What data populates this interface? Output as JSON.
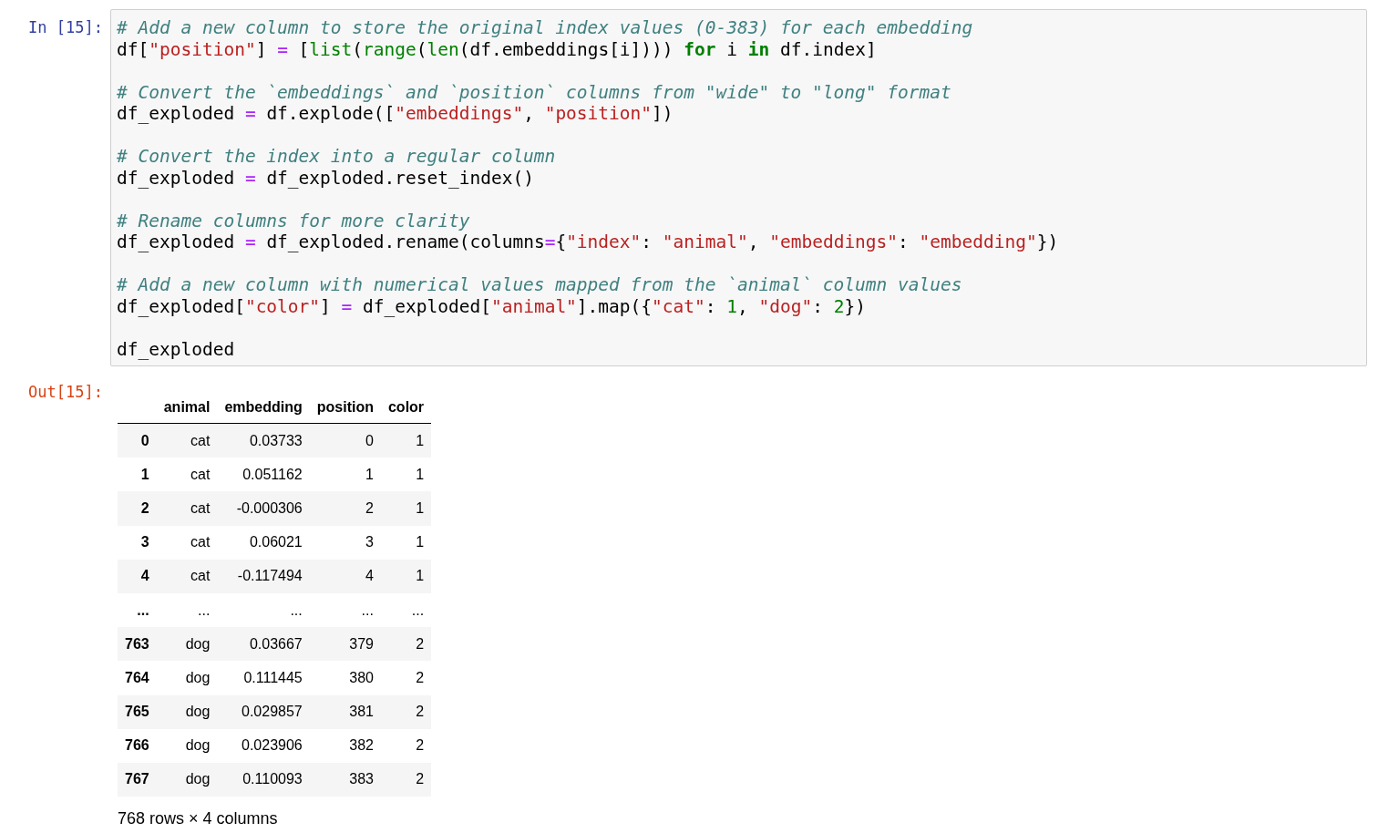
{
  "input_cell": {
    "prompt": "In [15]:",
    "blocks": [
      [
        [
          {
            "kind": "comment",
            "text": "# Add a new column to store the original index values (0-383) for each embedding"
          }
        ],
        [
          {
            "kind": "plain",
            "text": "df["
          },
          {
            "kind": "string",
            "text": "\"position\""
          },
          {
            "kind": "plain",
            "text": "] "
          },
          {
            "kind": "operator",
            "text": "="
          },
          {
            "kind": "plain",
            "text": " ["
          },
          {
            "kind": "builtin",
            "text": "list"
          },
          {
            "kind": "plain",
            "text": "("
          },
          {
            "kind": "builtin",
            "text": "range"
          },
          {
            "kind": "plain",
            "text": "("
          },
          {
            "kind": "builtin",
            "text": "len"
          },
          {
            "kind": "plain",
            "text": "(df.embeddings[i]))) "
          },
          {
            "kind": "keyword",
            "text": "for"
          },
          {
            "kind": "plain",
            "text": " i "
          },
          {
            "kind": "keyword",
            "text": "in"
          },
          {
            "kind": "plain",
            "text": " df.index]"
          }
        ]
      ],
      [
        [
          {
            "kind": "comment",
            "text": "# Convert the `embeddings` and `position` columns from \"wide\" to \"long\" format"
          }
        ],
        [
          {
            "kind": "plain",
            "text": "df_exploded "
          },
          {
            "kind": "operator",
            "text": "="
          },
          {
            "kind": "plain",
            "text": " df.explode(["
          },
          {
            "kind": "string",
            "text": "\"embeddings\""
          },
          {
            "kind": "plain",
            "text": ", "
          },
          {
            "kind": "string",
            "text": "\"position\""
          },
          {
            "kind": "plain",
            "text": "])"
          }
        ]
      ],
      [
        [
          {
            "kind": "comment",
            "text": "# Convert the index into a regular column"
          }
        ],
        [
          {
            "kind": "plain",
            "text": "df_exploded "
          },
          {
            "kind": "operator",
            "text": "="
          },
          {
            "kind": "plain",
            "text": " df_exploded.reset_index()"
          }
        ]
      ],
      [
        [
          {
            "kind": "comment",
            "text": "# Rename columns for more clarity"
          }
        ],
        [
          {
            "kind": "plain",
            "text": "df_exploded "
          },
          {
            "kind": "operator",
            "text": "="
          },
          {
            "kind": "plain",
            "text": " df_exploded.rename(columns"
          },
          {
            "kind": "operator",
            "text": "="
          },
          {
            "kind": "plain",
            "text": "{"
          },
          {
            "kind": "string",
            "text": "\"index\""
          },
          {
            "kind": "plain",
            "text": ": "
          },
          {
            "kind": "string",
            "text": "\"animal\""
          },
          {
            "kind": "plain",
            "text": ", "
          },
          {
            "kind": "string",
            "text": "\"embeddings\""
          },
          {
            "kind": "plain",
            "text": ": "
          },
          {
            "kind": "string",
            "text": "\"embedding\""
          },
          {
            "kind": "plain",
            "text": "})"
          }
        ]
      ],
      [
        [
          {
            "kind": "comment",
            "text": "# Add a new column with numerical values mapped from the `animal` column values"
          }
        ],
        [
          {
            "kind": "plain",
            "text": "df_exploded["
          },
          {
            "kind": "string",
            "text": "\"color\""
          },
          {
            "kind": "plain",
            "text": "] "
          },
          {
            "kind": "operator",
            "text": "="
          },
          {
            "kind": "plain",
            "text": " df_exploded["
          },
          {
            "kind": "string",
            "text": "\"animal\""
          },
          {
            "kind": "plain",
            "text": "].map({"
          },
          {
            "kind": "string",
            "text": "\"cat\""
          },
          {
            "kind": "plain",
            "text": ": "
          },
          {
            "kind": "number",
            "text": "1"
          },
          {
            "kind": "plain",
            "text": ", "
          },
          {
            "kind": "string",
            "text": "\"dog\""
          },
          {
            "kind": "plain",
            "text": ": "
          },
          {
            "kind": "number",
            "text": "2"
          },
          {
            "kind": "plain",
            "text": "})"
          }
        ]
      ],
      [
        [
          {
            "kind": "plain",
            "text": "df_exploded"
          }
        ]
      ]
    ]
  },
  "output_cell": {
    "prompt": "Out[15]:",
    "table": {
      "columns": [
        "animal",
        "embedding",
        "position",
        "color"
      ],
      "rows": [
        {
          "index": "0",
          "cells": [
            "cat",
            "0.03733",
            "0",
            "1"
          ]
        },
        {
          "index": "1",
          "cells": [
            "cat",
            "0.051162",
            "1",
            "1"
          ]
        },
        {
          "index": "2",
          "cells": [
            "cat",
            "-0.000306",
            "2",
            "1"
          ]
        },
        {
          "index": "3",
          "cells": [
            "cat",
            "0.06021",
            "3",
            "1"
          ]
        },
        {
          "index": "4",
          "cells": [
            "cat",
            "-0.117494",
            "4",
            "1"
          ]
        },
        {
          "index": "...",
          "cells": [
            "...",
            "...",
            "...",
            "..."
          ]
        },
        {
          "index": "763",
          "cells": [
            "dog",
            "0.03667",
            "379",
            "2"
          ]
        },
        {
          "index": "764",
          "cells": [
            "dog",
            "0.111445",
            "380",
            "2"
          ]
        },
        {
          "index": "765",
          "cells": [
            "dog",
            "0.029857",
            "381",
            "2"
          ]
        },
        {
          "index": "766",
          "cells": [
            "dog",
            "0.023906",
            "382",
            "2"
          ]
        },
        {
          "index": "767",
          "cells": [
            "dog",
            "0.110093",
            "383",
            "2"
          ]
        }
      ]
    },
    "footer": "768 rows × 4 columns"
  }
}
